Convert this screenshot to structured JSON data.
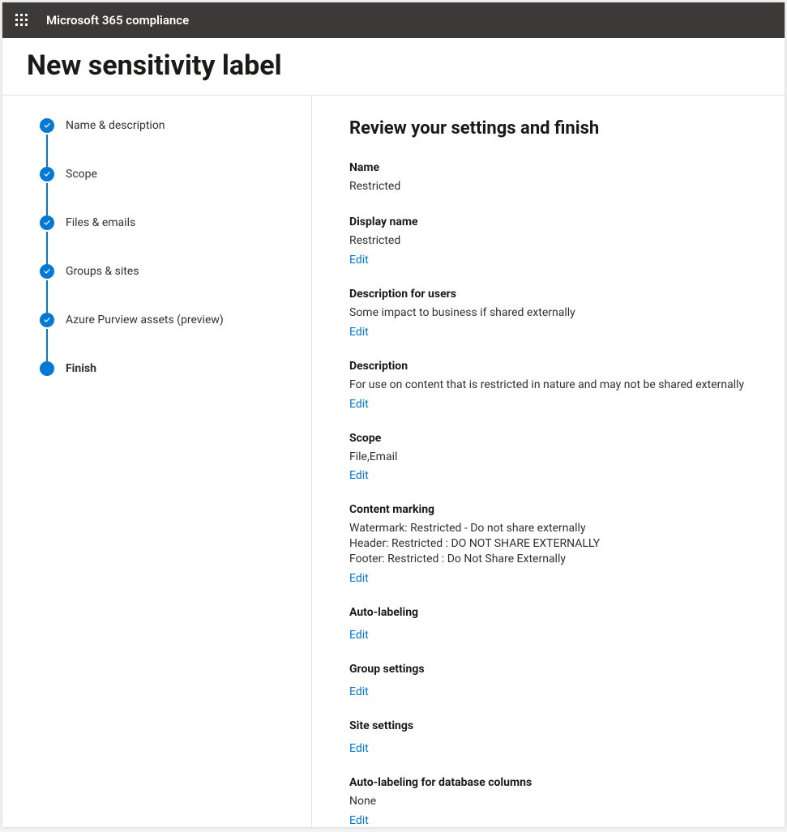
{
  "header": {
    "app_name": "Microsoft 365 compliance"
  },
  "page": {
    "title": "New sensitivity label"
  },
  "wizard": {
    "steps": [
      {
        "label": "Name & description",
        "state": "done"
      },
      {
        "label": "Scope",
        "state": "done"
      },
      {
        "label": "Files & emails",
        "state": "done"
      },
      {
        "label": "Groups & sites",
        "state": "done"
      },
      {
        "label": "Azure Purview assets (preview)",
        "state": "done"
      },
      {
        "label": "Finish",
        "state": "current"
      }
    ]
  },
  "review": {
    "heading": "Review your settings and finish",
    "edit_label": "Edit",
    "sections": {
      "name": {
        "label": "Name",
        "value": "Restricted"
      },
      "display_name": {
        "label": "Display name",
        "value": "Restricted"
      },
      "description_users": {
        "label": "Description for users",
        "value": "Some impact to business if shared externally"
      },
      "description": {
        "label": "Description",
        "value": "For use on content that is restricted in nature and may not be shared externally"
      },
      "scope": {
        "label": "Scope",
        "value": "File,Email"
      },
      "content_marking": {
        "label": "Content marking",
        "lines": [
          "Watermark: Restricted - Do not share externally",
          "Header: Restricted : DO NOT SHARE EXTERNALLY",
          "Footer: Restricted : Do Not Share Externally"
        ]
      },
      "auto_labeling": {
        "label": "Auto-labeling"
      },
      "group_settings": {
        "label": "Group settings"
      },
      "site_settings": {
        "label": "Site settings"
      },
      "auto_labeling_db": {
        "label": "Auto-labeling for database columns",
        "value": "None"
      }
    }
  }
}
